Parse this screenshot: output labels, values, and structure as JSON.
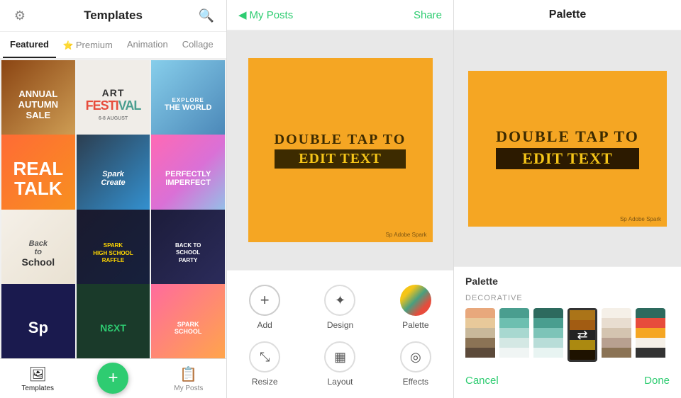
{
  "left": {
    "title": "Templates",
    "tabs": [
      {
        "label": "Featured",
        "active": true
      },
      {
        "label": "Premium",
        "premium": true,
        "active": false
      },
      {
        "label": "Animation",
        "active": false
      },
      {
        "label": "Collage",
        "active": false
      }
    ],
    "templates": [
      {
        "id": 1,
        "text": "ANNUAL AUTUMN SALE",
        "class": "t1"
      },
      {
        "id": 2,
        "text": "ART FESTIVAL",
        "class": "t2"
      },
      {
        "id": 3,
        "text": "EXPLORE THE WORLD",
        "class": "t3"
      },
      {
        "id": 4,
        "text": "REAL TALK",
        "class": "t4"
      },
      {
        "id": 5,
        "text": "Spark Create",
        "class": "t5"
      },
      {
        "id": 6,
        "text": "PERFECTLY IMPERFECT",
        "class": "t6"
      },
      {
        "id": 7,
        "text": "Back to School",
        "class": "t7"
      },
      {
        "id": 8,
        "text": "SPARK HIGH SCHOOL RAFFLE",
        "class": "t8"
      },
      {
        "id": 9,
        "text": "BACK TO SCHOOL PARTY",
        "class": "t9"
      },
      {
        "id": 10,
        "text": "",
        "class": "t10"
      },
      {
        "id": 11,
        "text": "",
        "class": "t11"
      },
      {
        "id": 12,
        "text": "SPARK SCHOOL",
        "class": "t12"
      }
    ],
    "nav": [
      {
        "label": "Templates",
        "icon": "🖼",
        "active": true
      },
      {
        "label": "",
        "icon": "+",
        "fab": true
      },
      {
        "label": "My Posts",
        "icon": "📋",
        "active": false
      }
    ]
  },
  "middle": {
    "back_label": "My Posts",
    "share_label": "Share",
    "canvas": {
      "line1": "DOUBLE TAP TO",
      "line2": "EDIT TEXT",
      "bg_color": "#f5a623",
      "badge": "Adobe Spark"
    },
    "tools": [
      {
        "label": "Add",
        "icon": "+"
      },
      {
        "label": "Design",
        "icon": "✦"
      },
      {
        "label": "Palette",
        "icon": "palette"
      },
      {
        "label": "Resize",
        "icon": "⤡"
      },
      {
        "label": "Layout",
        "icon": "▦"
      },
      {
        "label": "Effects",
        "icon": "◎"
      }
    ]
  },
  "right": {
    "header_title": "Palette",
    "canvas": {
      "line1": "DOUBLE TAP TO",
      "line2": "EDIT TEXT",
      "bg_color": "#f5a623",
      "badge": "Adobe Spark"
    },
    "palette": {
      "title": "Palette",
      "decorative_label": "DECORATIVE",
      "swatches": [
        {
          "id": 1,
          "colors": [
            "#e8a87c",
            "#e8c99a",
            "#c8b89a",
            "#8B7355",
            "#5c4a3a"
          ],
          "selected": false
        },
        {
          "id": 2,
          "colors": [
            "#4a9e8f",
            "#6dbfb0",
            "#a8d8d0",
            "#d4e8e4",
            "#f0f5f4"
          ],
          "selected": false
        },
        {
          "id": 3,
          "colors": [
            "#2d6a5e",
            "#4a9e8f",
            "#7dc4b8",
            "#b8ddd8",
            "#e8f4f2"
          ],
          "selected": false
        },
        {
          "id": 4,
          "colors": [
            "#f5a623",
            "#e8851a",
            "#333",
            "#f5c518",
            "#2c1a00"
          ],
          "selected": true
        },
        {
          "id": 5,
          "colors": [
            "#f5f0e8",
            "#e8ddd0",
            "#d4c4b0",
            "#b8a090",
            "#8B7355"
          ],
          "selected": false
        },
        {
          "id": 6,
          "colors": [
            "#2d6a5e",
            "#e74c3c",
            "#f5a623",
            "#f5f0e8",
            "#333"
          ],
          "selected": false
        }
      ],
      "cancel_label": "Cancel",
      "done_label": "Done"
    }
  }
}
